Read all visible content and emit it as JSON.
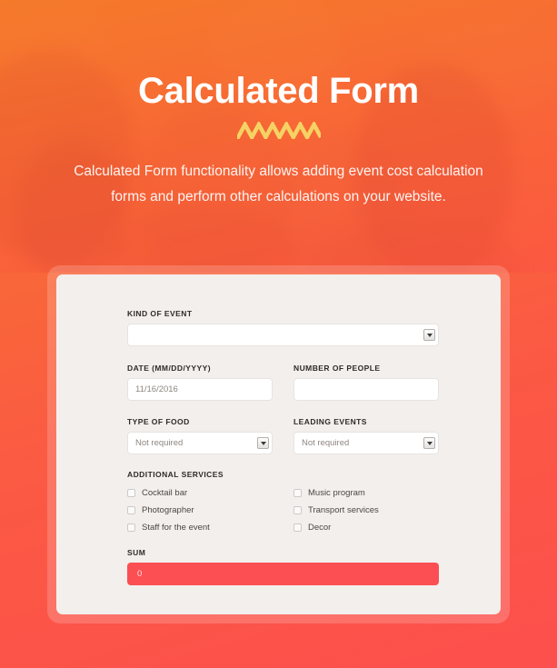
{
  "hero": {
    "title": "Calculated Form",
    "subtitle": "Calculated Form functionality allows adding event cost calculation forms and perform other calculations on your website.",
    "divider_icon": "zigzag-divider-icon",
    "divider_color": "#f5d264",
    "background_start": "#f5792b",
    "background_end": "#fd4f4d"
  },
  "form": {
    "kind_of_event": {
      "label": "Kind of event",
      "value": "",
      "icon": "chevron-down-icon"
    },
    "date": {
      "label": "Date (mm/dd/yyyy)",
      "value": "11/16/2016"
    },
    "number_of_people": {
      "label": "Number of people",
      "value": ""
    },
    "type_of_food": {
      "label": "Type of food",
      "value": "Not required",
      "icon": "chevron-down-icon"
    },
    "leading_events": {
      "label": "Leading events",
      "value": "Not required",
      "icon": "chevron-down-icon"
    },
    "additional_services": {
      "label": "Additional services",
      "left_column": [
        {
          "label": "Cocktail bar",
          "checked": false
        },
        {
          "label": "Photographer",
          "checked": false
        },
        {
          "label": "Staff for the event",
          "checked": false
        }
      ],
      "right_column": [
        {
          "label": "Music program",
          "checked": false
        },
        {
          "label": "Transport services",
          "checked": false
        },
        {
          "label": "Decor",
          "checked": false
        }
      ]
    },
    "sum": {
      "label": "Sum",
      "value": "0",
      "color": "#fb4f53"
    }
  }
}
